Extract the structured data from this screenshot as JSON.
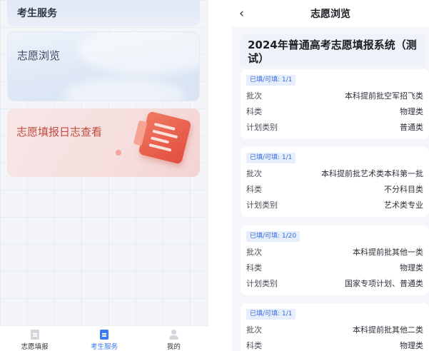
{
  "left": {
    "top_card": "考生服务",
    "browse_card": "志愿浏览",
    "log_card": "志愿填报日志查看",
    "nav": [
      {
        "label": "志愿填报",
        "icon": "document-icon",
        "active": false
      },
      {
        "label": "考生服务",
        "icon": "document-icon",
        "active": true
      },
      {
        "label": "我的",
        "icon": "user-icon",
        "active": false
      }
    ]
  },
  "right": {
    "back_glyph": "‹",
    "header_title": "志愿浏览",
    "system_title": "2024年普通高考志愿填报系统（测试）",
    "entries": [
      {
        "badge": "已填/可填: 1/1",
        "rows": [
          {
            "key": "批次",
            "value": "本科提前批空军招飞类"
          },
          {
            "key": "科类",
            "value": "物理类"
          },
          {
            "key": "计划类别",
            "value": "普通类"
          }
        ]
      },
      {
        "badge": "已填/可填: 1/1",
        "rows": [
          {
            "key": "批次",
            "value": "本科提前批艺术类本科第一批"
          },
          {
            "key": "科类",
            "value": "不分科目类"
          },
          {
            "key": "计划类别",
            "value": "艺术类专业"
          }
        ]
      },
      {
        "badge": "已填/可填: 1/20",
        "rows": [
          {
            "key": "批次",
            "value": "本科提前批其他一类"
          },
          {
            "key": "科类",
            "value": "物理类"
          },
          {
            "key": "计划类别",
            "value": "国家专项计划、普通类"
          }
        ]
      },
      {
        "badge": "已填/可填: 1/1",
        "rows": [
          {
            "key": "批次",
            "value": "本科提前批其他二类"
          },
          {
            "key": "科类",
            "value": "物理类"
          }
        ]
      }
    ]
  },
  "colors": {
    "accent": "#3a7bf0",
    "log_card_text": "#c24a3f",
    "badge_bg": "#e6eefb",
    "badge_text": "#3a6fd8"
  }
}
